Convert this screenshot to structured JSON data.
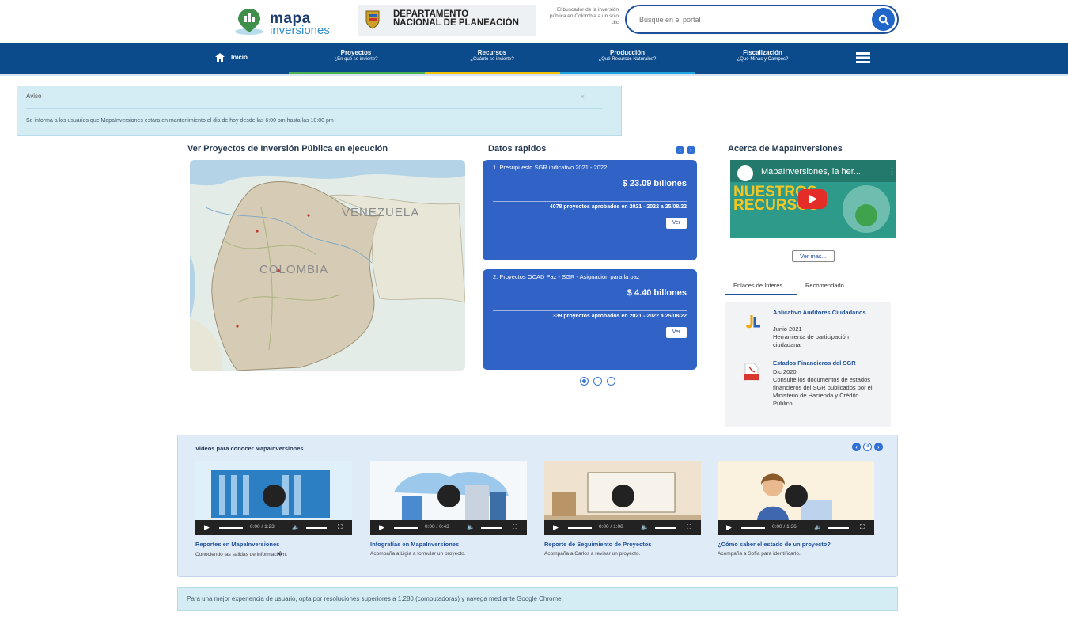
{
  "header": {
    "logo_line1": "mapa",
    "logo_line2": "inversiones",
    "dnp_line1": "DEPARTAMENTO",
    "dnp_line2": "NACIONAL DE PLANEACIÓN",
    "tagline": "El buscador de la inversión pública en Colombia a un solo clic",
    "search_placeholder": "Busque en el portal"
  },
  "nav": {
    "items": [
      {
        "title": "Inicio",
        "subtitle": ""
      },
      {
        "title": "Proyectos",
        "subtitle": "¿En qué se invierte?"
      },
      {
        "title": "Recursos",
        "subtitle": "¿Cuánto se invierte?"
      },
      {
        "title": "Producción",
        "subtitle": "¿Qué Recursos Naturales?"
      },
      {
        "title": "Fiscalización",
        "subtitle": "¿Qué Minas y Campos?"
      }
    ],
    "accent_colors": [
      "#4caf50",
      "#f2c200",
      "#1fa6e0"
    ]
  },
  "alert": {
    "title": "Aviso",
    "close": "×",
    "message": "Se informa a los usuarios que MapaInversiones estara en mantenimiento el dia de hoy desde las 6:00 pm hasta las 10:00 pm"
  },
  "map_section": {
    "title": "Ver Proyectos de Inversión Pública en ejecución",
    "label_venezuela": "VENEZUELA",
    "label_colombia": "COLOMBIA"
  },
  "datos": {
    "title": "Datos rápidos",
    "cards": [
      {
        "heading": "1. Presupuesto SGR indicativo 2021 - 2022",
        "value": "$ 23.09 billones",
        "note": "4078 proyectos aprobados en 2021 - 2022 a 25/08/22",
        "button": "Ver"
      },
      {
        "heading": "2. Proyectos OCAD Paz - SGR - Asignación para la paz",
        "value": "$ 4.40 billones",
        "note": "339 proyectos aprobados en 2021 - 2022 a 25/08/22",
        "button": "Ver"
      }
    ]
  },
  "acerca": {
    "title": "Acerca de MapaInversiones",
    "video_title": "MapaInversiones, la her...",
    "video_overlay": "NUESTROS RECURSOS",
    "ver_mas": "Ver mas...",
    "tabs": [
      "Enlaces de Interés",
      "Recomendado"
    ],
    "links": [
      {
        "title": "Aplicativo Auditores Ciudadanos",
        "date": "Junio 2021",
        "desc": "Herramienta de participación ciudadana."
      },
      {
        "title": "Estados Financieros del SGR",
        "date": "Dic 2020",
        "desc": "Consulte los documentos de estados financieros del SGR publicados por el Ministerio de Hacienda y Crédito Público"
      }
    ]
  },
  "videos": {
    "title": "Videos para conocer MapaInversiones",
    "items": [
      {
        "title": "Reportes en MapaInversiones",
        "subtitle": "Conociendo las salidas de informaci�n.",
        "time": "0:00 / 1:23"
      },
      {
        "title": "Infografías en MapaInversiones",
        "subtitle": "Acompaña a Ligia a formular un proyecto.",
        "time": "0:00 / 0:43"
      },
      {
        "title": "Reporte de Seguimiento de Proyectos",
        "subtitle": "Acompaña a Carlos a revisar un proyecto.",
        "time": "0:00 / 1:08"
      },
      {
        "title": "¿Cómo saber el estado de un proyecto?",
        "subtitle": "Acompaña a Sofía para identificarlo.",
        "time": "0:00 / 1:36"
      }
    ]
  },
  "footer": {
    "note": "Para una mejor experiencia de usuario, opta por resoluciones superiores a 1.280 (computadoras) y navega mediante Google Chrome."
  }
}
